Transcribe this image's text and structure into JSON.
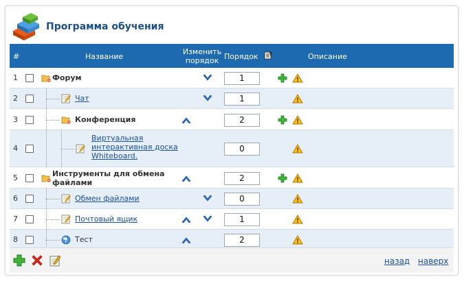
{
  "page": {
    "title": "Программа обучения"
  },
  "columns": {
    "num": "#",
    "name": "Название",
    "change_order": "Изменить порядок",
    "order": "Порядок",
    "description": "Описание"
  },
  "rows": [
    {
      "num": "1",
      "label": "Форум",
      "type": "folder",
      "style": "bold",
      "order": "1",
      "up": false,
      "down": true,
      "plus": true,
      "warn": true
    },
    {
      "num": "2",
      "label": "Чат",
      "type": "note",
      "style": "link",
      "order": "1",
      "up": false,
      "down": true,
      "plus": false,
      "warn": true
    },
    {
      "num": "3",
      "label": "Конференция",
      "type": "folder",
      "style": "bold",
      "order": "2",
      "up": true,
      "down": false,
      "plus": true,
      "warn": true
    },
    {
      "num": "4",
      "label": "Виртуальная интерактивная доска Whiteboard.",
      "type": "note",
      "style": "link",
      "order": "0",
      "up": false,
      "down": false,
      "plus": false,
      "warn": true
    },
    {
      "num": "5",
      "label": "Инструменты для обмена файлами",
      "type": "folder",
      "style": "bold",
      "order": "2",
      "up": true,
      "down": false,
      "plus": true,
      "warn": true
    },
    {
      "num": "6",
      "label": "Обмен файлами",
      "type": "note",
      "style": "link",
      "order": "0",
      "up": false,
      "down": true,
      "plus": false,
      "warn": true
    },
    {
      "num": "7",
      "label": "Почтовый ящик",
      "type": "note",
      "style": "link",
      "order": "1",
      "up": true,
      "down": true,
      "plus": false,
      "warn": true
    },
    {
      "num": "8",
      "label": "Тест",
      "type": "test",
      "style": "plain",
      "order": "2",
      "up": true,
      "down": false,
      "plus": false,
      "warn": true
    }
  ],
  "footer": {
    "back": "назад",
    "top": "наверх"
  },
  "colors": {
    "header_bg": "#1d6ab0",
    "title": "#1a4f8a",
    "link": "#1a4f9a",
    "alt_row": "#e6eff8"
  }
}
